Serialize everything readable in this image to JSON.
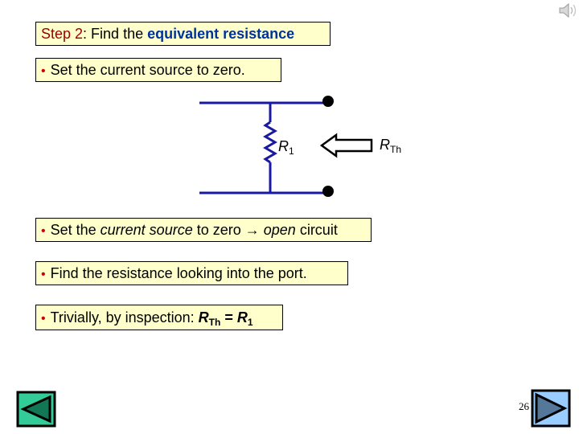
{
  "title": {
    "step": "Step 2",
    "colon": ": Find the ",
    "emphasis": "equivalent resistance"
  },
  "bullets": [
    {
      "text": "Set the current source to zero."
    },
    {
      "parts": [
        "Set the ",
        "current source",
        " to zero ",
        "→",
        " ",
        "open",
        " circuit"
      ]
    },
    {
      "text": "Find the resistance looking into the port."
    },
    {
      "parts": [
        "Trivially, by inspection: ",
        "R",
        "Th",
        " = ",
        "R",
        "1"
      ]
    }
  ],
  "bullet_glyph": "•",
  "circuit": {
    "resistor_label": "R",
    "resistor_sub": "1",
    "port_label": "R",
    "port_sub": "Th",
    "wire_color": "#1a1aa0"
  },
  "navigation": {
    "prev_icon": "back-arrow-icon",
    "next_icon": "forward-arrow-icon",
    "prev_color": "#33cc99",
    "next_color": "#99ccff"
  },
  "page_number": "26",
  "speaker_icon": "speaker-icon"
}
